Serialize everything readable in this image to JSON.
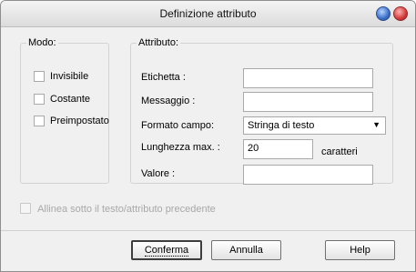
{
  "window": {
    "title": "Definizione attributo"
  },
  "modo": {
    "legend": "Modo:",
    "options": [
      {
        "label": "Invisibile",
        "checked": false
      },
      {
        "label": "Costante",
        "checked": false
      },
      {
        "label": "Preimpostato",
        "checked": false
      }
    ]
  },
  "attributo": {
    "legend": "Attributo:",
    "etichetta_label": "Etichetta :",
    "etichetta_value": "",
    "messaggio_label": "Messaggio :",
    "messaggio_value": "",
    "formato_label": "Formato campo:",
    "formato_value": "Stringa di testo",
    "lunghezza_label": "Lunghezza max. :",
    "lunghezza_value": "20",
    "lunghezza_unit": "caratteri",
    "valore_label": "Valore :",
    "valore_value": ""
  },
  "allinea": {
    "label": "Allinea sotto il testo/attributo precedente",
    "checked": false,
    "enabled": false
  },
  "buttons": {
    "conferma": "Conferma",
    "annulla": "Annulla",
    "help": "Help"
  },
  "colors": {
    "background": "#f0f0f0",
    "disabled_text": "#a8a8a8"
  }
}
